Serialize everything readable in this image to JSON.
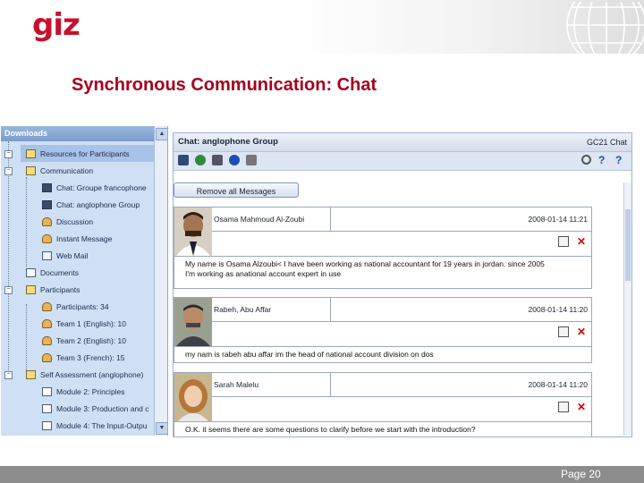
{
  "logo": "giz",
  "slide_title": "Synchronous Communication: Chat",
  "sidebar": {
    "header": "Downloads",
    "items": [
      {
        "label": "Resources for Participants",
        "icon": "folder-icon"
      },
      {
        "label": "Communication",
        "icon": "folder-icon"
      },
      {
        "label": "Chat: Groupe francophone",
        "icon": "chat-icon"
      },
      {
        "label": "Chat: anglophone Group",
        "icon": "chat-icon"
      },
      {
        "label": "Discussion",
        "icon": "discussion-icon"
      },
      {
        "label": "Instant Message",
        "icon": "instant-message-icon"
      },
      {
        "label": "Web Mail",
        "icon": "mail-icon"
      },
      {
        "label": "Documents",
        "icon": "document-icon"
      },
      {
        "label": "Participants",
        "icon": "folder-icon"
      },
      {
        "label": "Participants: 34",
        "icon": "user-icon"
      },
      {
        "label": "Team 1 (English): 10",
        "icon": "user-icon"
      },
      {
        "label": "Team 2 (English): 10",
        "icon": "user-icon"
      },
      {
        "label": "Team 3 (French): 15",
        "icon": "user-icon"
      },
      {
        "label": "Self Assessment (anglophone)",
        "icon": "folder-icon"
      },
      {
        "label": "Module 2: Principles",
        "icon": "document-icon"
      },
      {
        "label": "Module 3: Production and c",
        "icon": "document-icon"
      },
      {
        "label": "Module 4: The Input-Outpu",
        "icon": "document-icon"
      }
    ]
  },
  "chat": {
    "title": "Chat: anglophone Group",
    "brand": "GC21 Chat",
    "remove_button": "Remove all Messages",
    "messages": [
      {
        "name": "Osama Mahmoud Al-Zoubi",
        "date": "2008-01-14 11:21",
        "text_line1": "My name is Osama Alzoubi< I have been working as national accountant for 19 years in jordan. since 2005",
        "text_line2": "I'm working as anational account expert in use"
      },
      {
        "name": "Rabeh, Abu Affar",
        "date": "2008-01-14 11:20",
        "text_line1": "my nam is rabeh abu affar im the head of national account division on dos",
        "text_line2": ""
      },
      {
        "name": "Sarah Malelu",
        "date": "2008-01-14 11:20",
        "text_line1": "O.K. it seems there are some questions to clarify before we start with the introduction?",
        "text_line2": ""
      }
    ]
  },
  "footer": {
    "page": "Page 20"
  },
  "colors": {
    "brand_red": "#c8102e",
    "title_red": "#a5001c"
  }
}
